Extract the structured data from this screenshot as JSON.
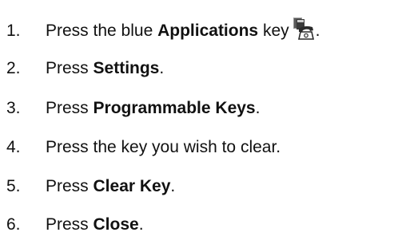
{
  "steps": [
    {
      "number": "1.",
      "before": "Press the blue ",
      "bold": "Applications",
      "after": " key",
      "icon": "phone-applications-key-icon",
      "end": "."
    },
    {
      "number": "2.",
      "before": "Press ",
      "bold": "Settings",
      "after": ".",
      "icon": "",
      "end": ""
    },
    {
      "number": "3.",
      "before": "Press ",
      "bold": "Programmable Keys",
      "after": ".",
      "icon": "",
      "end": ""
    },
    {
      "number": "4.",
      "before": "Press the key you wish to clear.",
      "bold": "",
      "after": "",
      "icon": "",
      "end": ""
    },
    {
      "number": "5.",
      "before": "Press ",
      "bold": "Clear Key",
      "after": ".",
      "icon": "",
      "end": ""
    },
    {
      "number": "6.",
      "before": "Press ",
      "bold": "Close",
      "after": ".",
      "icon": "",
      "end": ""
    }
  ],
  "colors": {
    "text": "#111111",
    "background": "#ffffff",
    "icon_dark": "#2a2a2a",
    "icon_light": "#9a9a9a"
  }
}
